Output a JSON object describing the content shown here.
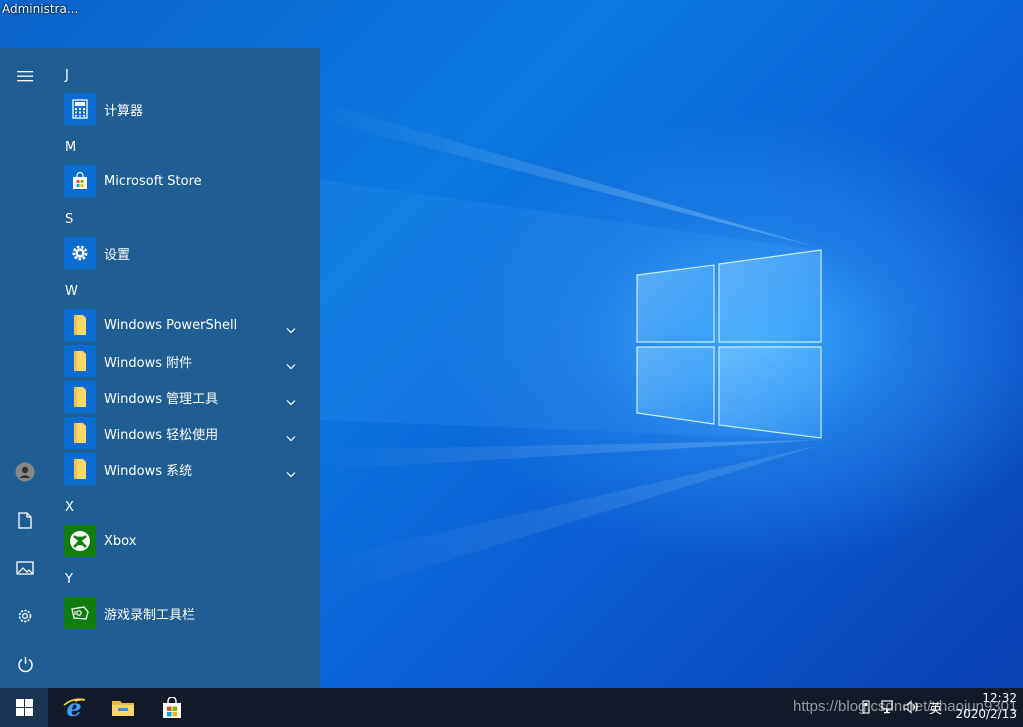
{
  "desktop": {
    "user_label": "Administra..."
  },
  "start_menu": {
    "groups": [
      {
        "letter": "J",
        "items": [
          {
            "label": "计算器",
            "icon": "calculator-icon"
          }
        ]
      },
      {
        "letter": "M",
        "items": [
          {
            "label": "Microsoft Store",
            "icon": "store-bag-icon"
          }
        ]
      },
      {
        "letter": "S",
        "items": [
          {
            "label": "设置",
            "icon": "gear-icon"
          }
        ]
      },
      {
        "letter": "W",
        "items": [
          {
            "label": "Windows PowerShell",
            "icon": "folder-icon",
            "expandable": true
          },
          {
            "label": "Windows 附件",
            "icon": "folder-icon",
            "expandable": true
          },
          {
            "label": "Windows 管理工具",
            "icon": "folder-icon",
            "expandable": true
          },
          {
            "label": "Windows 轻松使用",
            "icon": "folder-icon",
            "expandable": true
          },
          {
            "label": "Windows 系统",
            "icon": "folder-icon",
            "expandable": true
          }
        ]
      },
      {
        "letter": "X",
        "items": [
          {
            "label": "Xbox",
            "icon": "xbox-icon"
          }
        ]
      },
      {
        "letter": "Y",
        "items": [
          {
            "label": "游戏录制工具栏",
            "icon": "game-bar-icon"
          }
        ]
      }
    ],
    "rail": [
      "hamburger-menu-icon",
      "user-avatar-icon",
      "documents-icon",
      "pictures-icon",
      "settings-gear-icon",
      "power-icon"
    ]
  },
  "taskbar": {
    "pinned": [
      "start-windows-icon",
      "internet-explorer-icon",
      "file-explorer-icon",
      "microsoft-store-icon"
    ],
    "tray": {
      "ime_label": "英",
      "time": "12:32",
      "date": "2020/2/13"
    }
  },
  "watermark": "https://blog.csdn.net/zhaojun9301",
  "colors": {
    "start_menu_bg": "#1f5e93",
    "tile_blue": "#0a6bd1",
    "xbox_green": "#107c10",
    "taskbar_bg": "#101a29",
    "desktop_blue": "#0a78e0"
  }
}
